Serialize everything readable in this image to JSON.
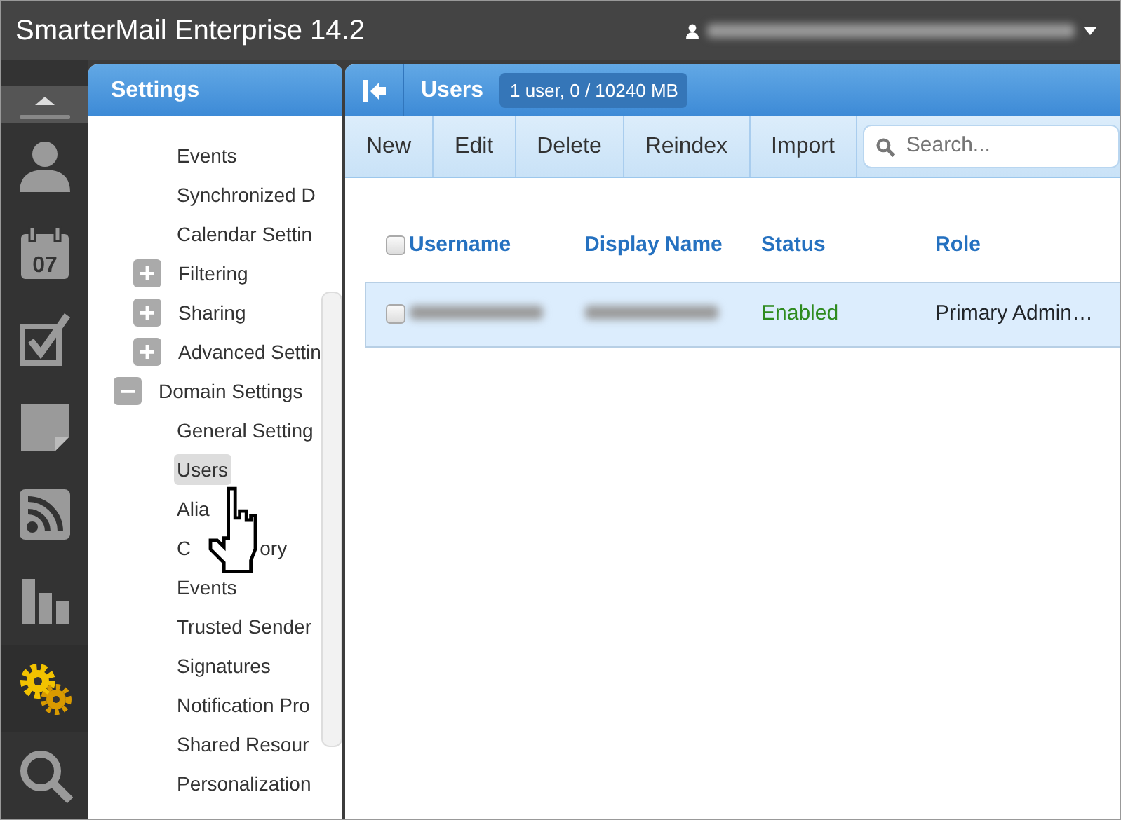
{
  "window": {
    "title": "SmarterMail Enterprise 14.2"
  },
  "rail": [
    {
      "kind": "user",
      "selected": false
    },
    {
      "kind": "calendar",
      "text": "07",
      "selected": false
    },
    {
      "kind": "tasks",
      "selected": false
    },
    {
      "kind": "note",
      "selected": false
    },
    {
      "kind": "rss",
      "selected": false
    },
    {
      "kind": "chart",
      "selected": false
    },
    {
      "kind": "gears",
      "selected": true
    },
    {
      "kind": "search",
      "selected": false
    }
  ],
  "settings": {
    "title": "Settings",
    "tree": [
      {
        "children": [
          {
            "label": "Events",
            "selected": false
          },
          {
            "label": "Synchronized D",
            "selected": false
          },
          {
            "label": "Calendar Settin",
            "selected": false
          },
          {
            "label": "Filtering",
            "expanded": false,
            "selected": false
          },
          {
            "label": "Sharing",
            "expanded": false,
            "selected": false
          },
          {
            "label": "Advanced Settin",
            "expanded": false,
            "selected": false
          }
        ]
      },
      {
        "label": "Domain Settings",
        "expanded": true,
        "selected": false,
        "children": [
          {
            "label": "General Setting",
            "selected": false
          },
          {
            "label": "Users",
            "selected": true
          },
          {
            "label": "Alia",
            "selected": false
          },
          {
            "label": "C",
            "label_tail": "ory",
            "selected": false
          },
          {
            "label": "Events",
            "selected": false
          },
          {
            "label": "Trusted Sender",
            "selected": false
          },
          {
            "label": "Signatures",
            "selected": false
          },
          {
            "label": "Notification Pro",
            "selected": false
          },
          {
            "label": "Shared Resour",
            "selected": false
          },
          {
            "label": "Personalization",
            "selected": false
          }
        ]
      }
    ]
  },
  "users": {
    "title": "Users",
    "badge": "1 user, 0 / 10240 MB",
    "toolbar": [
      "New",
      "Edit",
      "Delete",
      "Reindex",
      "Import"
    ],
    "search": {
      "placeholder": "Search..."
    },
    "columns": [
      "Username",
      "Display Name",
      "Status",
      "Role"
    ],
    "header_checked": false,
    "rows": [
      {
        "selected": true,
        "checked": false,
        "status": "Enabled",
        "role": "Primary Admin…"
      }
    ]
  }
}
